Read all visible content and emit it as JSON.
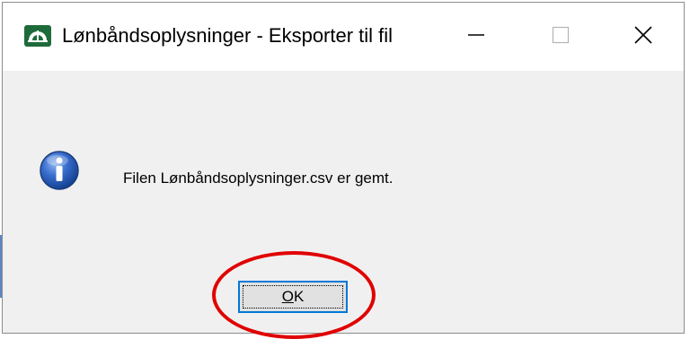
{
  "window": {
    "title": "Lønbåndsoplysninger - Eksporter til fil",
    "app_icon": "dome-app-icon",
    "controls": {
      "minimize_icon": "minimize-icon",
      "maximize_icon": "maximize-icon",
      "close_icon": "close-icon"
    }
  },
  "dialog": {
    "icon": "info-icon",
    "message": "Filen Lønbåndsoplysninger.csv er gemt.",
    "ok_button": {
      "accesskey": "O",
      "rest": "K"
    }
  },
  "colors": {
    "accent": "#0078d7",
    "annotation_ring": "#e00000",
    "dialog_bg": "#f0f0f0",
    "app_icon_green": "#1d6b3a"
  }
}
